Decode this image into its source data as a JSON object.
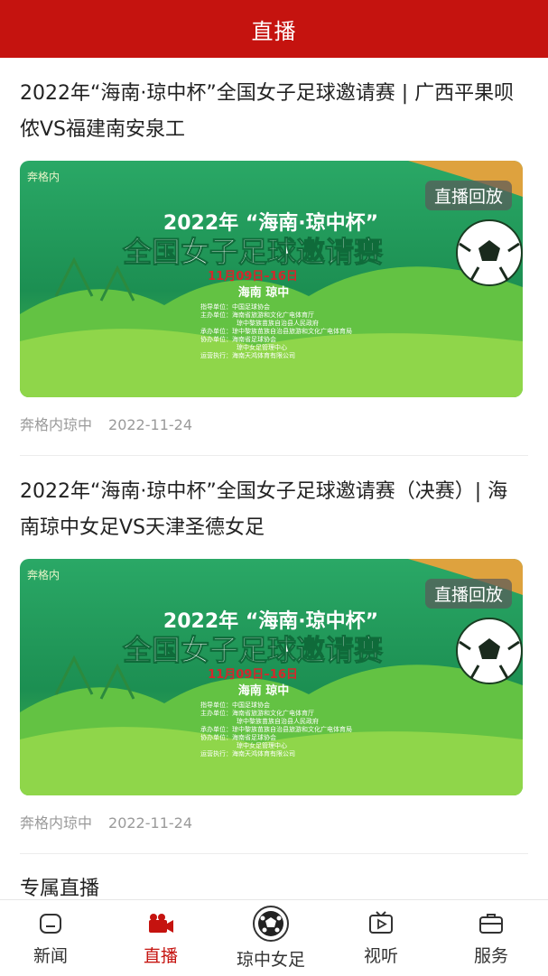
{
  "header": {
    "title": "直播"
  },
  "articles": [
    {
      "title": "2022年“海南·琼中杯”全国女子足球邀请赛 | 广西平果呗侬VS福建南安泉工",
      "badge": "直播回放",
      "source": "奔格内琼中",
      "date": "2022-11-24",
      "poster": {
        "logo": "奔格内",
        "year_text": "2022年",
        "cup_text": "“海南·琼中杯”",
        "main_text": "全国女子足球邀请赛",
        "dates": "11月09日–16日",
        "place": "海南  琼中",
        "credits": [
          "指导单位：中国足球协会",
          "主办单位：海南省旅游和文化广电体育厅",
          "琼中黎族苗族自治县人民政府",
          "承办单位：琼中黎族苗族自治县旅游和文化广电体育局",
          "协办单位：海南省足球协会",
          "琼中女足管理中心",
          "运营执行：海南天鸿体育有限公司"
        ]
      }
    },
    {
      "title": "2022年“海南·琼中杯”全国女子足球邀请赛（决赛）| 海南琼中女足VS天津圣德女足",
      "badge": "直播回放",
      "source": "奔格内琼中",
      "date": "2022-11-24",
      "poster": {
        "logo": "奔格内",
        "year_text": "2022年",
        "cup_text": "“海南·琼中杯”",
        "main_text": "全国女子足球邀请赛",
        "dates": "11月09日–16日",
        "place": "海南  琼中",
        "credits": [
          "指导单位：中国足球协会",
          "主办单位：海南省旅游和文化广电体育厅",
          "琼中黎族苗族自治县人民政府",
          "承办单位：琼中黎族苗族自治县旅游和文化广电体育局",
          "协办单位：海南省足球协会",
          "琼中女足管理中心",
          "运营执行：海南天鸿体育有限公司"
        ]
      }
    }
  ],
  "section": {
    "title": "专属直播"
  },
  "tabs": [
    {
      "label": "新闻",
      "icon": "news-icon"
    },
    {
      "label": "直播",
      "icon": "video-camera-icon"
    },
    {
      "label": "琼中女足",
      "icon": "soccer-ball-icon"
    },
    {
      "label": "视听",
      "icon": "tv-icon"
    },
    {
      "label": "服务",
      "icon": "briefcase-icon"
    }
  ],
  "colors": {
    "brand": "#c5130f",
    "poster_green": "#1f9a55"
  }
}
